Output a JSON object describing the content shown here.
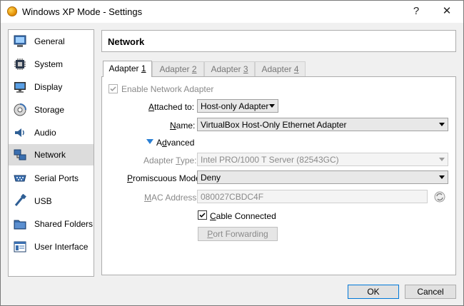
{
  "window": {
    "title": "Windows XP Mode - Settings",
    "help_glyph": "?",
    "close_glyph": "✕"
  },
  "sidebar": {
    "items": [
      {
        "label": "General",
        "icon": "general-icon"
      },
      {
        "label": "System",
        "icon": "system-icon"
      },
      {
        "label": "Display",
        "icon": "display-icon"
      },
      {
        "label": "Storage",
        "icon": "storage-icon"
      },
      {
        "label": "Audio",
        "icon": "audio-icon"
      },
      {
        "label": "Network",
        "icon": "network-icon",
        "selected": true
      },
      {
        "label": "Serial Ports",
        "icon": "serial-ports-icon"
      },
      {
        "label": "USB",
        "icon": "usb-icon"
      },
      {
        "label": "Shared Folders",
        "icon": "shared-folders-icon"
      },
      {
        "label": "User Interface",
        "icon": "user-interface-icon"
      }
    ]
  },
  "header": {
    "title": "Network"
  },
  "tabs": [
    {
      "label": "Adapter ",
      "num": "1",
      "active": true
    },
    {
      "label": "Adapter ",
      "num": "2"
    },
    {
      "label": "Adapter ",
      "num": "3"
    },
    {
      "label": "Adapter ",
      "num": "4"
    }
  ],
  "form": {
    "enable_label": "Enable Network Adapter",
    "enable_checked": true,
    "attached_label_u": "A",
    "attached_label_rest": "ttached to:",
    "attached_value": "Host-only Adapter",
    "name_label_u": "N",
    "name_label_rest": "ame:",
    "name_value": "VirtualBox Host-Only Ethernet Adapter",
    "advanced_label_u": "d",
    "advanced_label_pre": "A",
    "advanced_label_rest": "vanced",
    "adapter_type_label_pre": "Adapter ",
    "adapter_type_label_u": "T",
    "adapter_type_label_rest": "ype:",
    "adapter_type_value": "Intel PRO/1000 T Server (82543GC)",
    "promiscuous_label_u": "P",
    "promiscuous_label_rest": "romiscuous Mode:",
    "promiscuous_value": "Deny",
    "mac_label_u": "M",
    "mac_label_rest": "AC Address:",
    "mac_value": "080027CBDC4F",
    "cable_label_u": "C",
    "cable_label_rest": "able Connected",
    "cable_checked": true,
    "port_forwarding_u": "P",
    "port_forwarding_rest": "ort Forwarding"
  },
  "footer": {
    "ok_label": "OK",
    "cancel_label": "Cancel"
  },
  "colors": {
    "accent": "#0078d7",
    "selected_bg": "#dcdcdc",
    "tri": "#2a7fd4"
  }
}
